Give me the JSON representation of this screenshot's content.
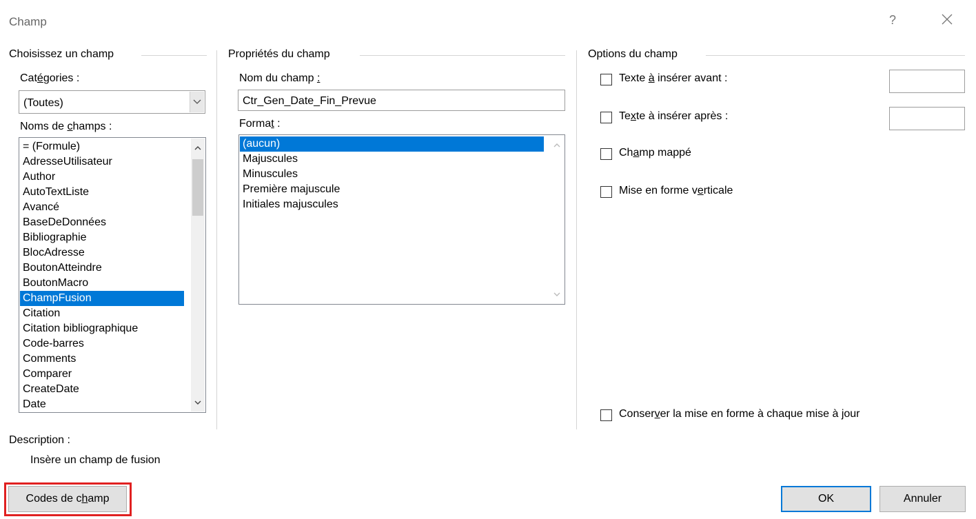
{
  "window": {
    "title": "Champ",
    "help_label": "?"
  },
  "left": {
    "section_title": "Choisissez un champ",
    "categories_label": {
      "pre": "Cat",
      "under": "é",
      "post": "gories :"
    },
    "categories_value": "(Toutes)",
    "field_names_label": {
      "pre": "Noms de ",
      "under": "c",
      "post": "hamps :"
    },
    "field_names": [
      "= (Formule)",
      "AdresseUtilisateur",
      "Author",
      "AutoTextListe",
      "Avancé",
      "BaseDeDonnées",
      "Bibliographie",
      "BlocAdresse",
      "BoutonAtteindre",
      "BoutonMacro",
      "ChampFusion",
      "Citation",
      "Citation bibliographique",
      "Code-barres",
      "Comments",
      "Comparer",
      "CreateDate",
      "Date"
    ],
    "selected_field": "ChampFusion",
    "description_label": "Description :",
    "description_text": "Insère un champ de fusion"
  },
  "middle": {
    "section_title": "Propriétés du champ",
    "field_name_label": {
      "pre": "Nom du champ ",
      "under": ":",
      "post": ""
    },
    "field_name_value": "Ctr_Gen_Date_Fin_Prevue",
    "format_label": {
      "pre": "Forma",
      "under": "t",
      "post": " :"
    },
    "formats": [
      "(aucun)",
      "Majuscules",
      "Minuscules",
      "Première majuscule",
      "Initiales majuscules"
    ],
    "selected_format": "(aucun)"
  },
  "right": {
    "section_title": "Options du champ",
    "text_before": {
      "pre": "Texte ",
      "under": "à",
      "post": " insérer avant :",
      "checked": false,
      "value": ""
    },
    "text_after": {
      "pre": "Te",
      "under": "x",
      "post": "te à insérer après :",
      "checked": false,
      "value": ""
    },
    "mapped_field": {
      "pre": "Ch",
      "under": "a",
      "post": "mp mappé",
      "checked": false
    },
    "vertical_format": {
      "pre": "Mise en forme v",
      "under": "e",
      "post": "rticale",
      "checked": false
    },
    "preserve_format": {
      "pre": "Conser",
      "under": "v",
      "post": "er la mise en forme à chaque mise à jour",
      "checked": false
    }
  },
  "buttons": {
    "field_codes": {
      "pre": "Codes de c",
      "under": "h",
      "post": "amp"
    },
    "ok": "OK",
    "cancel": "Annuler"
  },
  "colors": {
    "selection": "#0078d7",
    "highlight_frame": "#e02020"
  }
}
